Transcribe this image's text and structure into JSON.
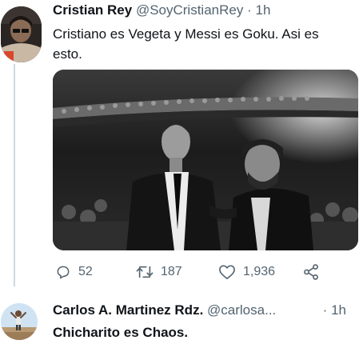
{
  "tweets": [
    {
      "author_name": "Cristian Rey",
      "handle": "@SoyCristianRey",
      "separator": "·",
      "time": "1h",
      "text_line1": "Cristiano es Vegeta y Messi es Goku. Asi es",
      "text_line2": "esto.",
      "media": "black-and-white photo of two footballers greeting at an awards gala",
      "actions": {
        "reply_icon": "reply-icon",
        "reply_count": "52",
        "retweet_icon": "retweet-icon",
        "retweet_count": "187",
        "like_icon": "heart-icon",
        "like_count": "1,936",
        "share_icon": "share-icon"
      }
    },
    {
      "author_name": "Carlos A. Martinez Rdz.",
      "handle": "@carlosa...",
      "separator": "·",
      "time": "1h",
      "text_bold": "Chicharito",
      "text_rest": " es Chaos."
    }
  ],
  "colors": {
    "text_primary": "#0f1419",
    "text_secondary": "#536471",
    "thread_line": "#cfd9de"
  }
}
